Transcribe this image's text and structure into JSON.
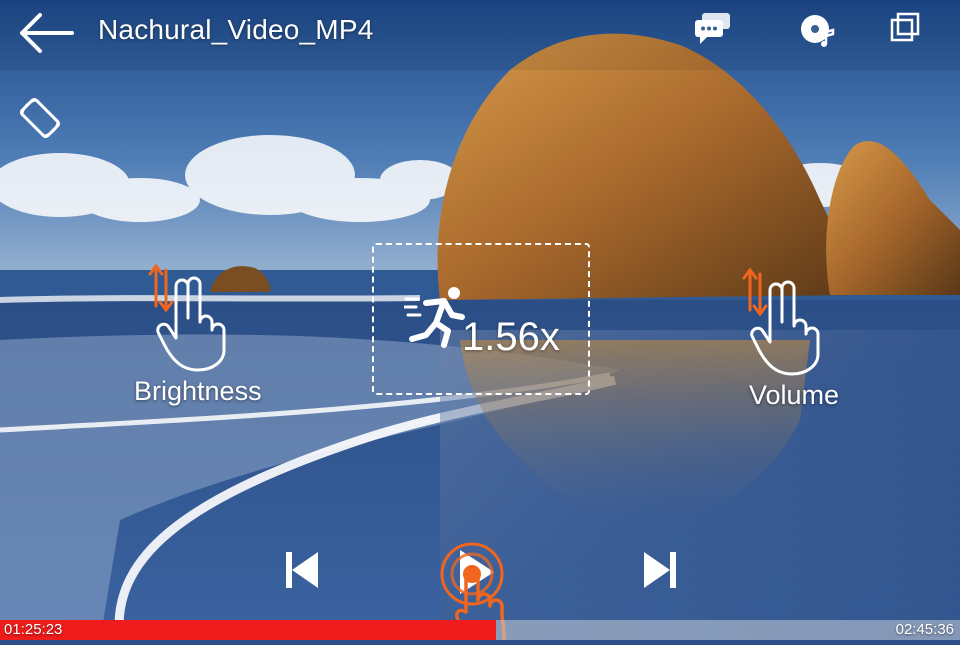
{
  "header": {
    "title": "Nachural_Video_MP4",
    "icons": [
      "back-arrow-icon",
      "subtitles-icon",
      "audio-track-icon",
      "popup-window-icon",
      "screen-rotate-icon"
    ]
  },
  "gestures": {
    "brightness_label": "Brightness",
    "volume_label": "Volume"
  },
  "speed": {
    "value": "1.56x",
    "icon": "running-person-icon"
  },
  "controls": {
    "icons": [
      "skip-previous-icon",
      "play-icon",
      "skip-next-icon",
      "tap-finger-icon"
    ]
  },
  "playback": {
    "current_time": "01:25:23",
    "total_time": "02:45:36",
    "progress_fraction": 0.517
  },
  "colors": {
    "accent": "#f0661e",
    "progress": "#ee1c1c"
  }
}
